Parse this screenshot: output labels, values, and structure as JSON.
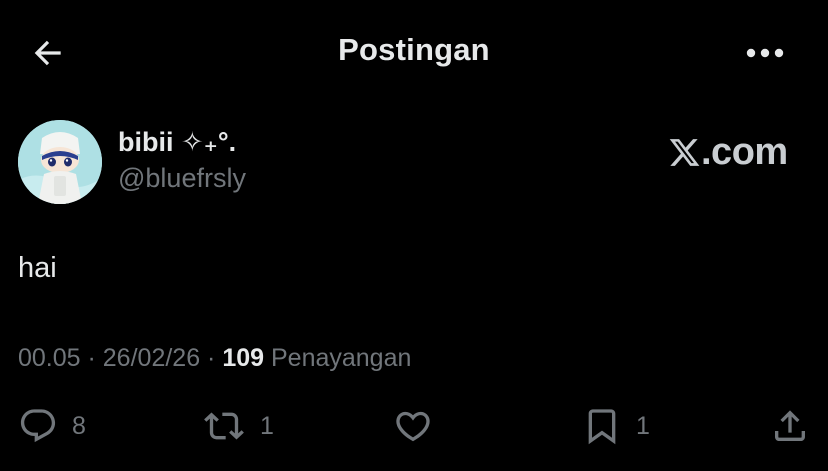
{
  "header": {
    "title": "Postingan",
    "back_icon": "arrow-left-icon",
    "more_icon": "more-horizontal-icon"
  },
  "author": {
    "name": "bibii ✧₊°.",
    "handle": "@bluefrsly",
    "avatar": "avatar-plush-doll"
  },
  "watermark": {
    "logo_icon": "x-logo-icon",
    "text": ".com"
  },
  "post": {
    "text": "hai"
  },
  "meta": {
    "time": "00.05",
    "sep1": " · ",
    "date": "26/02/26",
    "sep2": " · ",
    "views_count": "109",
    "views_label": " Penayangan"
  },
  "actions": {
    "reply": {
      "icon": "reply-icon",
      "count": "8"
    },
    "repost": {
      "icon": "repost-icon",
      "count": "1"
    },
    "like": {
      "icon": "heart-icon",
      "count": ""
    },
    "bookmark": {
      "icon": "bookmark-icon",
      "count": "1"
    },
    "share": {
      "icon": "share-icon"
    }
  },
  "colors": {
    "background": "#000000",
    "text_primary": "#e7e9ea",
    "text_secondary": "#71767b"
  }
}
